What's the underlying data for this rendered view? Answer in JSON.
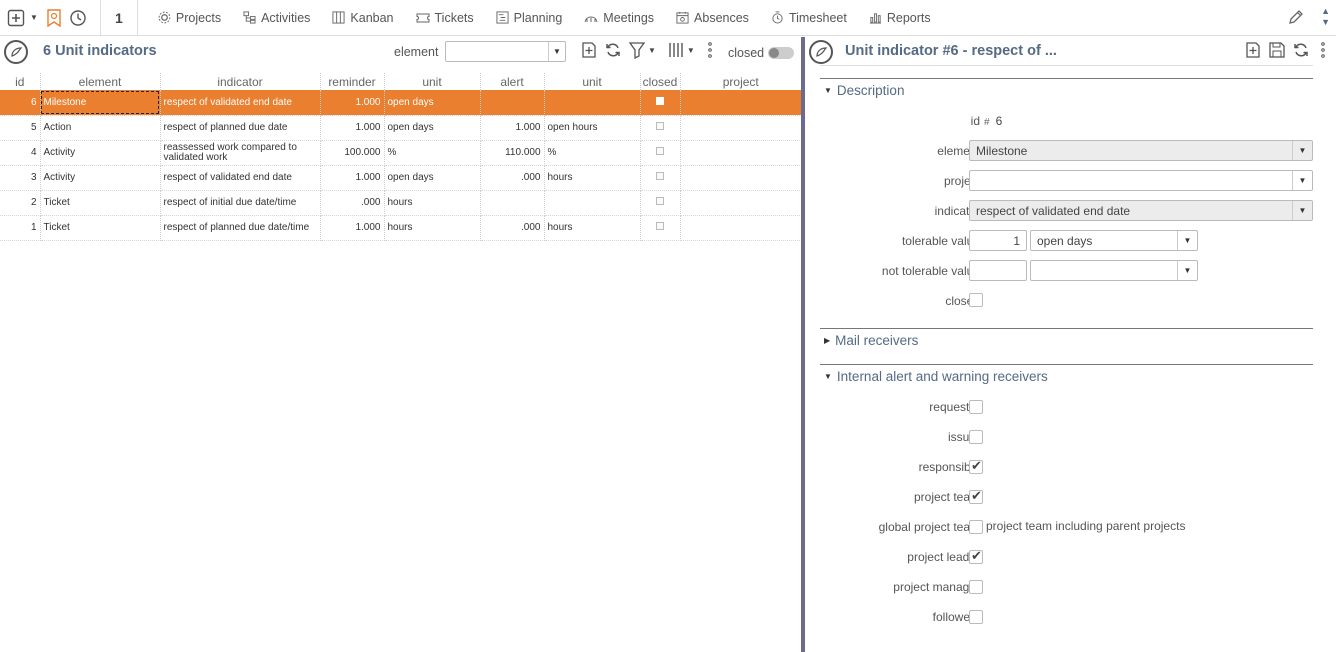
{
  "topbar": {
    "counter": "1",
    "menu": [
      {
        "label": "Projects",
        "icon": "gear-icon"
      },
      {
        "label": "Activities",
        "icon": "activities-icon"
      },
      {
        "label": "Kanban",
        "icon": "kanban-icon"
      },
      {
        "label": "Tickets",
        "icon": "ticket-icon"
      },
      {
        "label": "Planning",
        "icon": "planning-icon"
      },
      {
        "label": "Meetings",
        "icon": "meetings-icon"
      },
      {
        "label": "Absences",
        "icon": "absences-icon"
      },
      {
        "label": "Timesheet",
        "icon": "timesheet-icon"
      },
      {
        "label": "Reports",
        "icon": "reports-icon"
      }
    ]
  },
  "list": {
    "title": "6 Unit indicators",
    "filter_label": "element",
    "filter_value": "",
    "closed_label": "closed",
    "columns": [
      "id",
      "element",
      "indicator",
      "reminder",
      "unit",
      "alert",
      "unit",
      "closed",
      "project"
    ],
    "rows": [
      {
        "id": "6",
        "element": "Milestone",
        "indicator": "respect of validated end date",
        "reminder": "1.000",
        "unit": "open days",
        "alert": "",
        "alert_unit": "",
        "project": ""
      },
      {
        "id": "5",
        "element": "Action",
        "indicator": "respect of planned due date",
        "reminder": "1.000",
        "unit": "open days",
        "alert": "1.000",
        "alert_unit": "open hours",
        "project": ""
      },
      {
        "id": "4",
        "element": "Activity",
        "indicator": "reassessed work compared to validated work",
        "reminder": "100.000",
        "unit": "%",
        "alert": "110.000",
        "alert_unit": "%",
        "project": ""
      },
      {
        "id": "3",
        "element": "Activity",
        "indicator": "respect of validated end date",
        "reminder": "1.000",
        "unit": "open days",
        "alert": ".000",
        "alert_unit": "hours",
        "project": ""
      },
      {
        "id": "2",
        "element": "Ticket",
        "indicator": "respect of initial due date/time",
        "reminder": ".000",
        "unit": "hours",
        "alert": "",
        "alert_unit": "",
        "project": ""
      },
      {
        "id": "1",
        "element": "Ticket",
        "indicator": "respect of planned due date/time",
        "reminder": "1.000",
        "unit": "hours",
        "alert": ".000",
        "alert_unit": "hours",
        "project": ""
      }
    ]
  },
  "detail": {
    "title": "Unit indicator  #6  - respect of ...",
    "sections": {
      "description": "Description",
      "mail": "Mail receivers",
      "internal": "Internal alert and warning receivers"
    },
    "fields": {
      "id_label": "id",
      "id_hash": "#",
      "id_value": "6",
      "element_label": "element",
      "element_value": "Milestone",
      "project_label": "project",
      "project_value": "",
      "indicator_label": "indicator",
      "indicator_value": "respect of validated end date",
      "tolerable_label": "tolerable value",
      "tolerable_value": "1",
      "tolerable_unit": "open days",
      "not_tolerable_label": "not tolerable value",
      "not_tolerable_value": "",
      "not_tolerable_unit": "",
      "closed_label": "closed"
    },
    "receivers": {
      "requestor": "requestor",
      "issuer": "issuer",
      "responsible": "responsible",
      "project_team": "project team",
      "global_project_team": "global project team",
      "global_project_team_desc": "project team including parent projects",
      "project_leader": "project leader",
      "project_manager": "project manager",
      "followers": "followers"
    }
  }
}
